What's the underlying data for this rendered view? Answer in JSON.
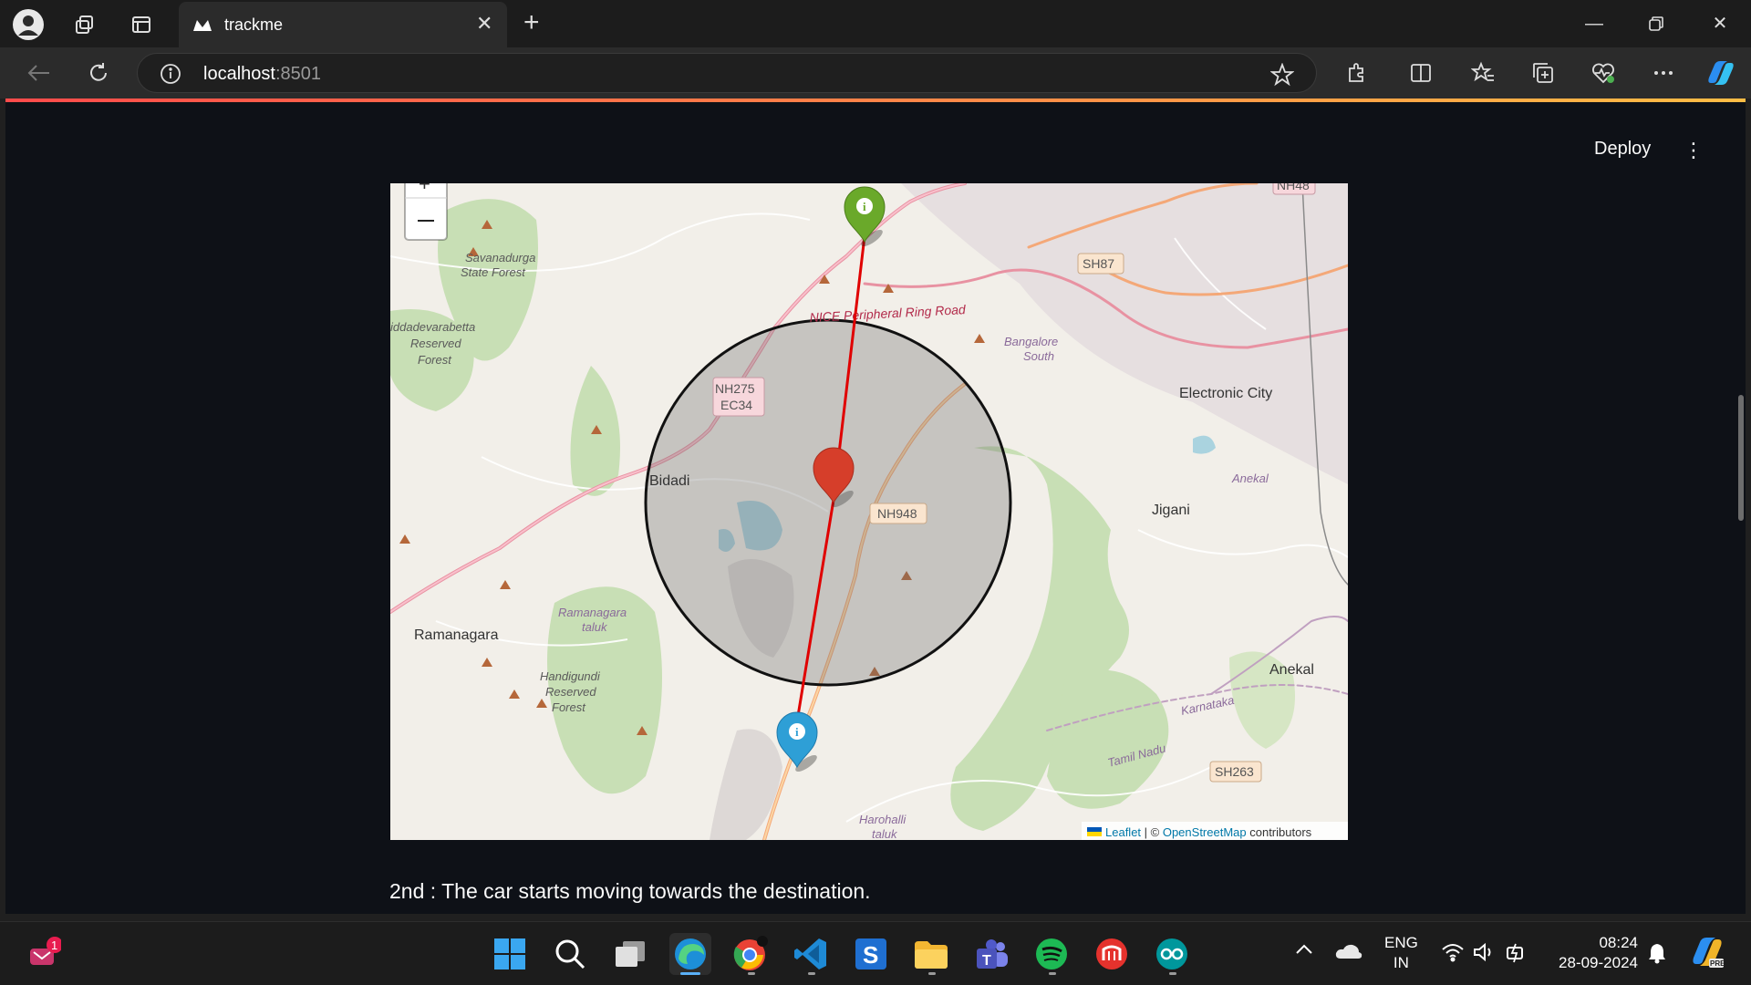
{
  "browser": {
    "tab_title": "trackme",
    "url_host": "localhost",
    "url_port": ":8501"
  },
  "app": {
    "deploy_label": "Deploy",
    "caption": "2nd : The car starts moving towards the destination."
  },
  "map": {
    "zoom_out_label": "–",
    "attribution_leaflet": "Leaflet",
    "attribution_sep": " | © ",
    "attribution_osm": "OpenStreetMap",
    "attribution_tail": " contributors",
    "places": {
      "savanadurga": "Savanadurga",
      "state_forest": "State Forest",
      "iddadevarabetta": "iddadevarabetta",
      "reserved": "Reserved",
      "forest": "Forest",
      "nice_road": "NICE Peripheral Ring Road",
      "bangalore_south_1": "Bangalore",
      "bangalore_south_2": "South",
      "electronic_city": "Electronic City",
      "nh275": "NH275",
      "ec34": "EC34",
      "bidadi": "Bidadi",
      "nh948": "NH948",
      "anekal_italic": "Anekal",
      "jigani": "Jigani",
      "ramanagara": "Ramanagara",
      "ramanagara_taluk_1": "Ramanagara",
      "ramanagara_taluk_2": "taluk",
      "handigundi_1": "Handigundi",
      "handigundi_2": "Reserved",
      "handigundi_3": "Forest",
      "anekal": "Anekal",
      "karnataka": "Karnataka",
      "tamil_nadu": "Tamil Nadu",
      "sh263": "SH263",
      "sh87": "SH87",
      "nh48": "NH48",
      "harohalli_1": "Harohalli",
      "harohalli_2": "taluk"
    },
    "colors": {
      "route": "#e00000",
      "start_marker": "#6aa92a",
      "end_marker": "#2e9fd6",
      "car_marker": "#d63e2a",
      "circle_fill": "rgba(110,110,110,0.35)"
    }
  },
  "taskbar": {
    "lang_1": "ENG",
    "lang_2": "IN",
    "time": "08:24",
    "date": "28-09-2024",
    "notification_badge": "1"
  }
}
